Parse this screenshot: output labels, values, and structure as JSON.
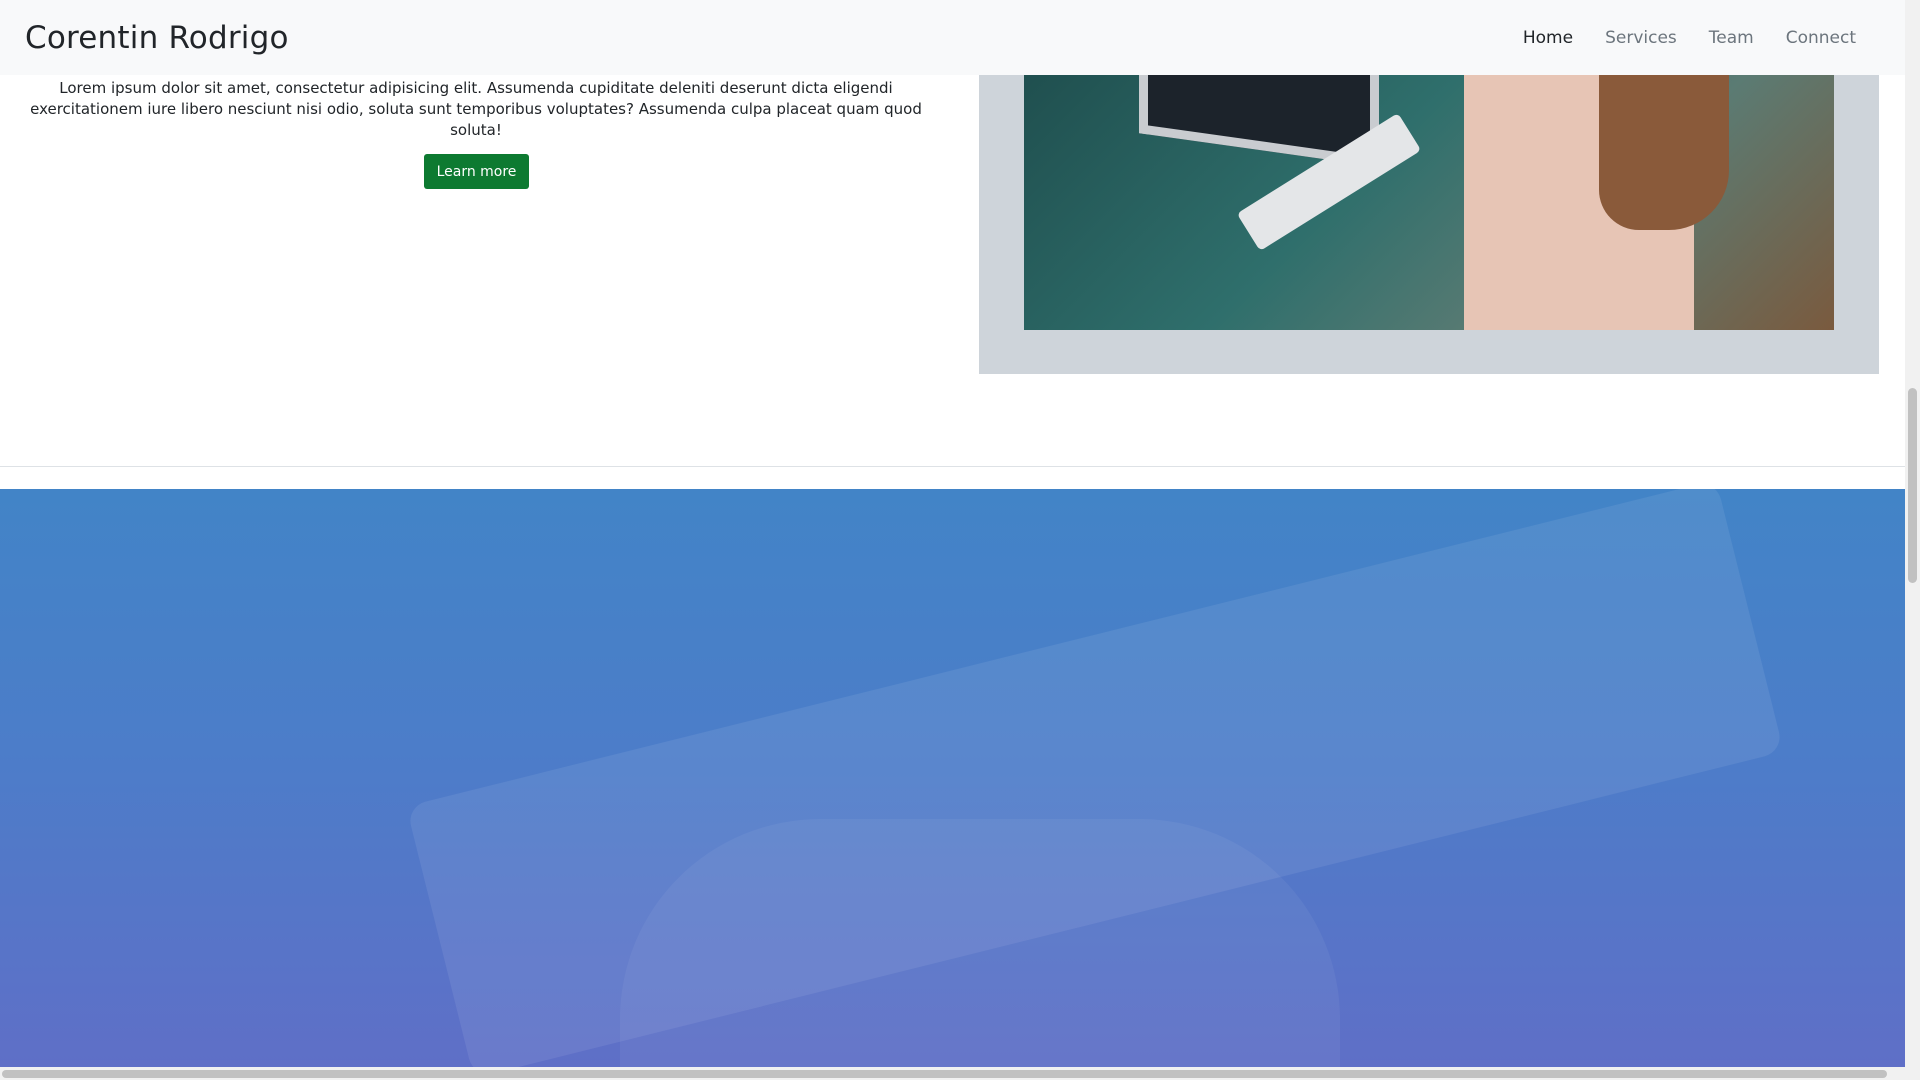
{
  "navbar": {
    "brand": "Corentin Rodrigo",
    "links": [
      {
        "label": "Home",
        "active": true
      },
      {
        "label": "Services",
        "active": false
      },
      {
        "label": "Team",
        "active": false
      },
      {
        "label": "Connect",
        "active": false
      }
    ]
  },
  "about": {
    "text": "Lorem ipsum dolor sit amet, consectetur adipisicing elit. Assumenda cupiditate deleniti deserunt dicta eligendi exercitationem iure libero nesciunt nisi odio, soluta sunt temporibus voluptates? Assumenda culpa placeat quam quod soluta!",
    "button_label": "Learn more"
  },
  "colors": {
    "navbar_bg": "#f8f9fa",
    "button_bg": "#0d7a31",
    "image_frame_bg": "#ced4da",
    "hero_top": "#4284c7",
    "hero_bottom": "#5f6fc7"
  }
}
